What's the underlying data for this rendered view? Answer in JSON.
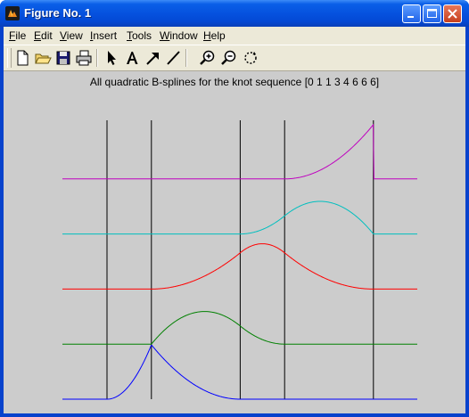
{
  "window": {
    "title": "Figure No. 1"
  },
  "menu": {
    "items": [
      {
        "label": "File",
        "key": "F",
        "rest": "ile"
      },
      {
        "label": "Edit",
        "key": "E",
        "rest": "dit"
      },
      {
        "label": "View",
        "key": "V",
        "rest": "iew"
      },
      {
        "label": "Insert",
        "key": "I",
        "rest": "nsert"
      },
      {
        "label": "Tools",
        "key": "T",
        "rest": "ools"
      },
      {
        "label": "Window",
        "key": "W",
        "rest": "indow"
      },
      {
        "label": "Help",
        "key": "H",
        "rest": "elp"
      }
    ]
  },
  "toolbar": {
    "tools": [
      "new-file-icon",
      "open-folder-icon",
      "save-disk-icon",
      "print-icon",
      "select-arrow-icon",
      "insert-text-icon",
      "insert-arrow-icon",
      "insert-line-icon",
      "zoom-in-icon",
      "zoom-out-icon",
      "rotate-icon"
    ]
  },
  "chart_data": {
    "type": "line",
    "title": "All quadratic B-splines for the knot sequence  [0 1 1 3 4 6 6 6]",
    "knots": [
      0,
      1,
      1,
      3,
      4,
      6,
      6,
      6
    ],
    "xlim": [
      -1,
      7
    ],
    "vertical_lines_at": [
      0,
      1,
      3,
      4,
      6
    ],
    "grid": false,
    "series": [
      {
        "color": "#0000ff",
        "offset": 0
      },
      {
        "color": "#008000",
        "offset": 1
      },
      {
        "color": "#ff0000",
        "offset": 2
      },
      {
        "color": "#00bfbf",
        "offset": 3
      },
      {
        "color": "#bf00bf",
        "offset": 4
      }
    ]
  }
}
